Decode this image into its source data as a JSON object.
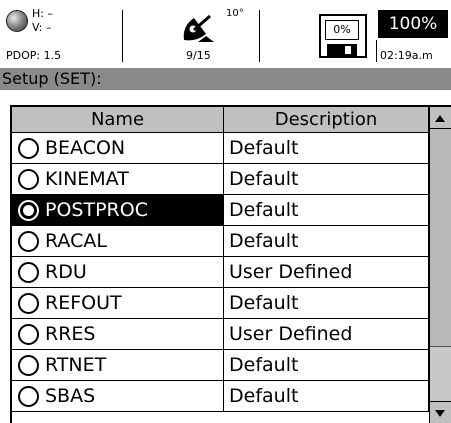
{
  "status_bar": {
    "h_label": "H: –",
    "v_label": "V: –",
    "pdop": "PDOP: 1.5",
    "elevation_mask": "10°",
    "satellites": "9/15",
    "memory_used": "0%",
    "battery": "100%",
    "time": "02:19a.m"
  },
  "title": "Setup (SET):",
  "table": {
    "headers": [
      "Name",
      "Description"
    ],
    "rows": [
      {
        "name": "BEACON",
        "description": "Default",
        "selected": false
      },
      {
        "name": "KINEMAT",
        "description": "Default",
        "selected": false
      },
      {
        "name": "POSTPROC",
        "description": "Default",
        "selected": true
      },
      {
        "name": "RACAL",
        "description": "Default",
        "selected": false
      },
      {
        "name": "RDU",
        "description": "User Defined",
        "selected": false
      },
      {
        "name": "REFOUT",
        "description": "Default",
        "selected": false
      },
      {
        "name": "RRES",
        "description": "User Defined",
        "selected": false
      },
      {
        "name": "RTNET",
        "description": "Default",
        "selected": false
      },
      {
        "name": "SBAS",
        "description": "Default",
        "selected": false
      }
    ]
  },
  "icons": {
    "gps_status": "gps-status-orb-icon",
    "satellite": "satellite-dish-icon",
    "memory": "floppy-disk-icon",
    "scroll_up": "arrow-up-icon",
    "scroll_down": "arrow-down-icon"
  },
  "colors": {
    "title_bar_bg": "#8a8a8a",
    "header_bg": "#c0c0c0",
    "selected_bg": "#000000",
    "selected_fg": "#ffffff"
  }
}
